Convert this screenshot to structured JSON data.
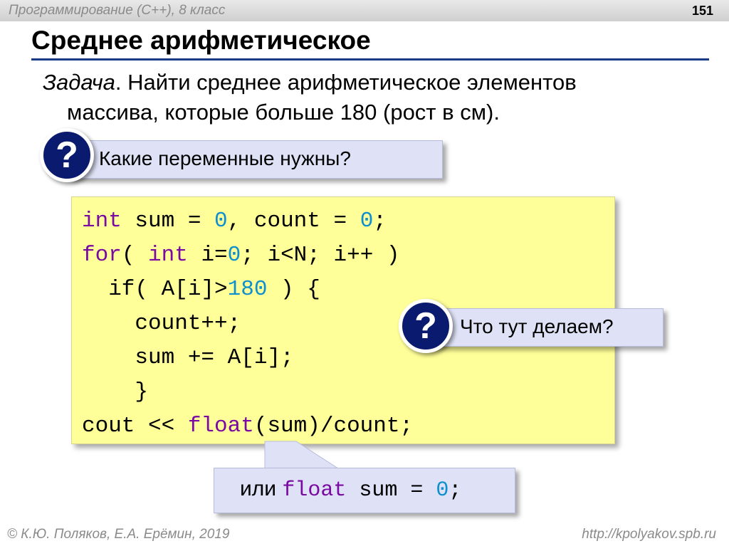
{
  "header": {
    "course": "Программирование (С++), 8 класс",
    "slide_number": "151"
  },
  "title": "Среднее арифметическое",
  "task": {
    "label": "Задача",
    "line1_rest": ". Найти среднее арифметическое элементов",
    "line2": "массива, которые больше 180 (рост в см)."
  },
  "questions": {
    "q1": {
      "icon": "question-mark-icon",
      "mark": "?",
      "text": "Какие переменные нужны?"
    },
    "q2": {
      "icon": "question-mark-icon",
      "mark": "?",
      "text": "Что тут делаем?"
    }
  },
  "code": {
    "line1": {
      "kw_int": "int",
      "a": " sum = ",
      "n0": "0",
      "b": ", count = ",
      "n1": "0",
      "c": ";"
    },
    "line2": {
      "kw_for": "for",
      "a": "( ",
      "kw_int": "int",
      "b": " i=",
      "n0": "0",
      "c": "; i<N; i++ )"
    },
    "line3": {
      "a": "  if( A[i]>",
      "n180": "180",
      "b": " ) {"
    },
    "line4": "    count++;",
    "line5": "    sum += A[i];",
    "line6": "    }",
    "line7": {
      "a": "cout << ",
      "kw_float": "float",
      "b": "(sum)/count;"
    }
  },
  "alternative": {
    "word": "или ",
    "kw_float": "float",
    "a": " sum = ",
    "n0": "0",
    "b": ";"
  },
  "footer": {
    "authors": "© К.Ю. Поляков, Е.А. Ерёмин, 2019",
    "url": "http://kpolyakov.spb.ru"
  },
  "colors": {
    "title_rule": "#1c3a8a",
    "keyword": "#7a0aa3",
    "number": "#0d8fd0",
    "code_background": "#ffff99",
    "callout_background": "#dfe2f6",
    "question_circle": "#0a1a6e"
  }
}
